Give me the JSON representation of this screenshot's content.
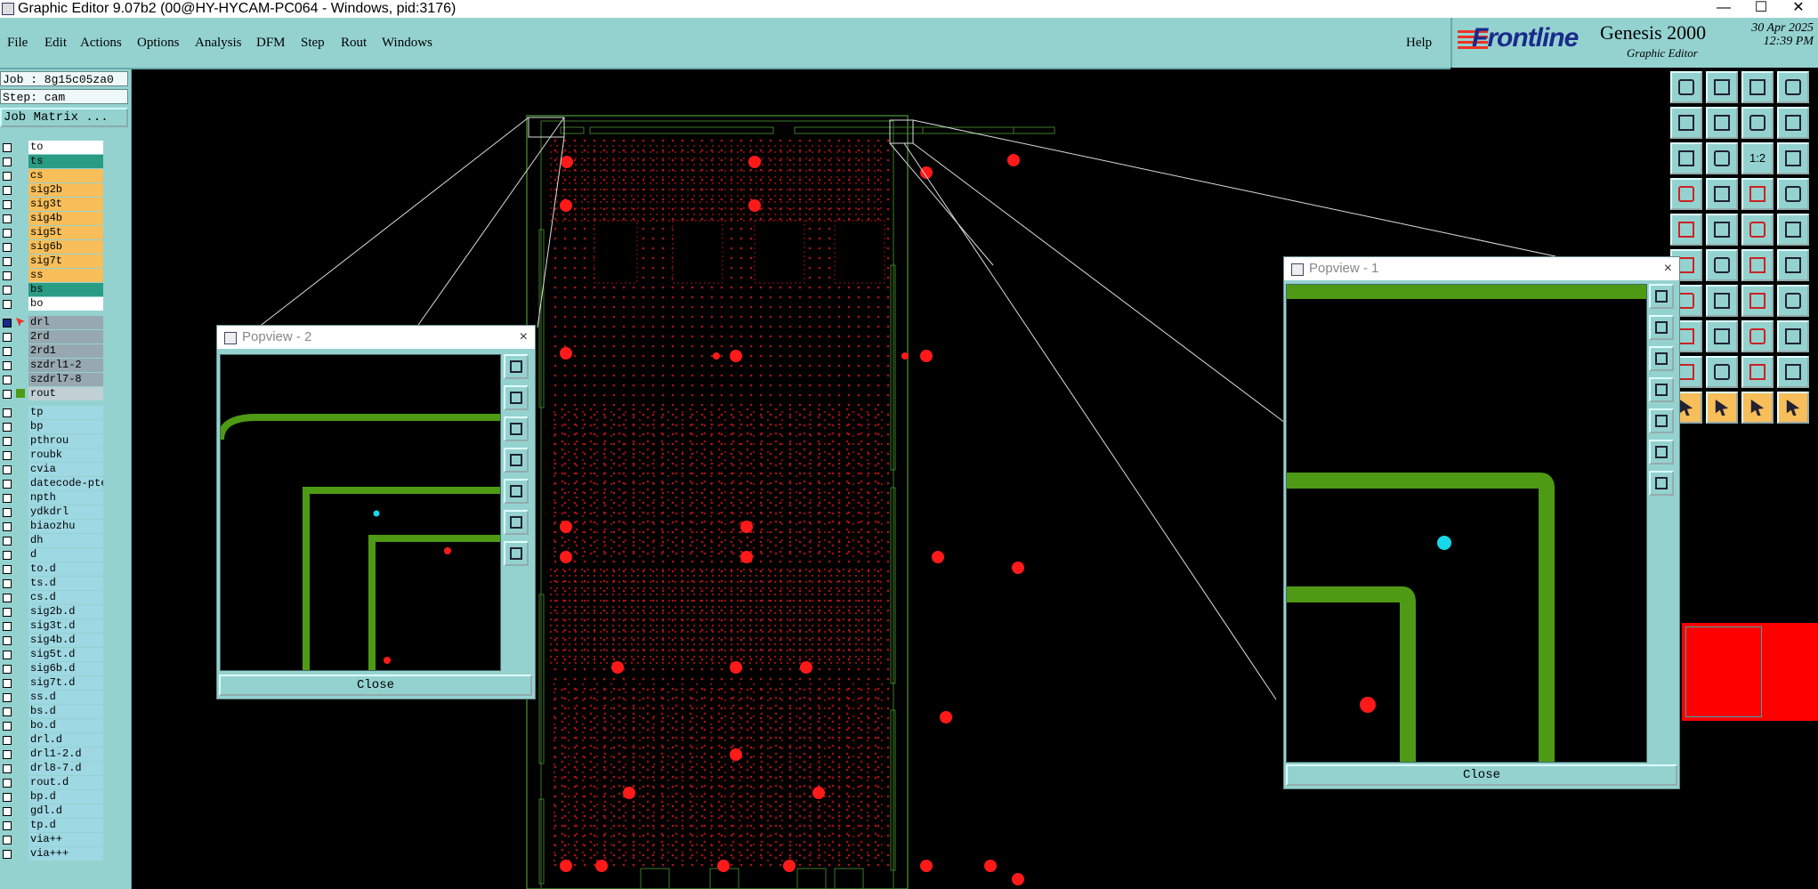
{
  "window": {
    "title": "Graphic Editor 9.07b2 (00@HY-HYCAM-PC064 - Windows, pid:3176)",
    "minimize": "—",
    "maximize": "☐",
    "close": "✕"
  },
  "menu": {
    "items": [
      "File",
      "Edit",
      "Actions",
      "Options",
      "Analysis",
      "DFM",
      "Step",
      "Rout",
      "Windows"
    ],
    "help": "Help"
  },
  "brand": {
    "logo": "Frontline",
    "product": "Genesis 2000",
    "module": "Graphic Editor",
    "date": "30 Apr 2025",
    "time": "12:39 PM"
  },
  "job": {
    "job_label": "Job : 8g15c05za0",
    "step_label": "Step: cam",
    "matrix_button": "Job Matrix ..."
  },
  "layers": [
    {
      "name": "to",
      "color": "white"
    },
    {
      "name": "ts",
      "color": "teal"
    },
    {
      "name": "cs",
      "color": "orange"
    },
    {
      "name": "sig2b",
      "color": "orange"
    },
    {
      "name": "sig3t",
      "color": "orange"
    },
    {
      "name": "sig4b",
      "color": "orange"
    },
    {
      "name": "sig5t",
      "color": "orange"
    },
    {
      "name": "sig6b",
      "color": "orange"
    },
    {
      "name": "sig7t",
      "color": "orange"
    },
    {
      "name": "ss",
      "color": "orange"
    },
    {
      "name": "bs",
      "color": "teal"
    },
    {
      "name": "bo",
      "color": "white"
    },
    {
      "name": "drl",
      "color": "gray",
      "active": true
    },
    {
      "name": "2rd",
      "color": "gray"
    },
    {
      "name": "2rd1",
      "color": "gray"
    },
    {
      "name": "szdrl1-2",
      "color": "gray"
    },
    {
      "name": "szdrl7-8",
      "color": "gray"
    },
    {
      "name": "rout",
      "color": "light",
      "affected": true
    },
    {
      "name": "tp",
      "color": "cyan"
    },
    {
      "name": "bp",
      "color": "cyan"
    },
    {
      "name": "pthrou",
      "color": "cyan"
    },
    {
      "name": "roubk",
      "color": "cyan"
    },
    {
      "name": "cvia",
      "color": "cyan"
    },
    {
      "name": "datecode-pte",
      "color": "cyan"
    },
    {
      "name": "npth",
      "color": "cyan"
    },
    {
      "name": "ydkdrl",
      "color": "cyan"
    },
    {
      "name": "biaozhu",
      "color": "cyan"
    },
    {
      "name": "dh",
      "color": "cyan"
    },
    {
      "name": "d",
      "color": "cyan"
    },
    {
      "name": "to.d",
      "color": "cyan"
    },
    {
      "name": "ts.d",
      "color": "cyan"
    },
    {
      "name": "cs.d",
      "color": "cyan"
    },
    {
      "name": "sig2b.d",
      "color": "cyan"
    },
    {
      "name": "sig3t.d",
      "color": "cyan"
    },
    {
      "name": "sig4b.d",
      "color": "cyan"
    },
    {
      "name": "sig5t.d",
      "color": "cyan"
    },
    {
      "name": "sig6b.d",
      "color": "cyan"
    },
    {
      "name": "sig7t.d",
      "color": "cyan"
    },
    {
      "name": "ss.d",
      "color": "cyan"
    },
    {
      "name": "bs.d",
      "color": "cyan"
    },
    {
      "name": "bo.d",
      "color": "cyan"
    },
    {
      "name": "drl.d",
      "color": "cyan"
    },
    {
      "name": "drl1-2.d",
      "color": "cyan"
    },
    {
      "name": "drl8-7.d",
      "color": "cyan"
    },
    {
      "name": "rout.d",
      "color": "cyan"
    },
    {
      "name": "bp.d",
      "color": "cyan"
    },
    {
      "name": "gdl.d",
      "color": "cyan"
    },
    {
      "name": "tp.d",
      "color": "cyan"
    },
    {
      "name": "via++",
      "color": "cyan"
    },
    {
      "name": "via+++",
      "color": "cyan"
    }
  ],
  "popup1": {
    "title": "Popview - 1",
    "close_x": "×",
    "close_label": "Close"
  },
  "popup2": {
    "title": "Popview - 2",
    "close_x": "×",
    "close_label": "Close"
  },
  "toolbar": {
    "ratio_label": "1:2"
  },
  "colors": {
    "panel": "#94d2d0",
    "drill": "#e8141a",
    "rout": "#4f9a14",
    "highlight": "#16d8e8"
  }
}
